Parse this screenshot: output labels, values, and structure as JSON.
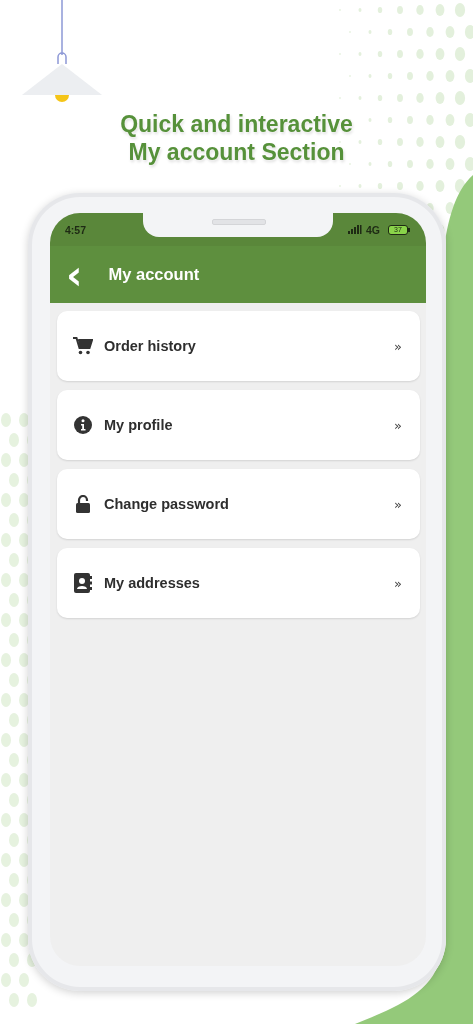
{
  "headline": [
    "Quick and interactive",
    "My account Section"
  ],
  "status_bar": {
    "time": "4:57",
    "network": "4G",
    "battery": "37"
  },
  "header": {
    "back": "‹",
    "title": "My account"
  },
  "menu": [
    {
      "label": "Order history",
      "chevron": "»"
    },
    {
      "label": "My profile",
      "chevron": "»"
    },
    {
      "label": "Change password",
      "chevron": "»"
    },
    {
      "label": "My addresses",
      "chevron": "»"
    }
  ]
}
